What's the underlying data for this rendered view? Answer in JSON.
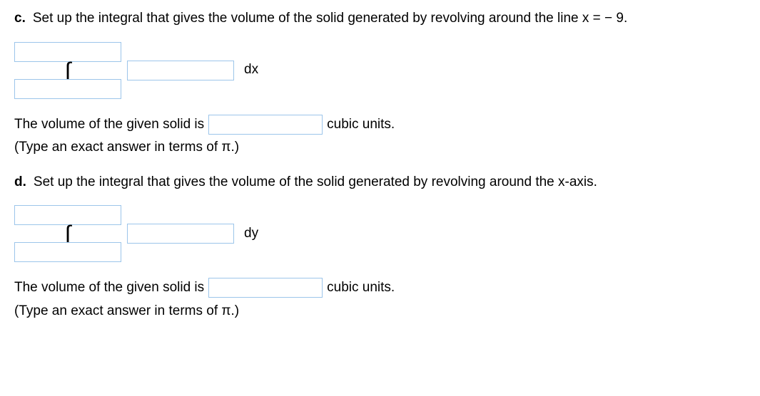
{
  "parts": {
    "c": {
      "letter": "c.",
      "prompt": "Set up the integral that gives the volume of the solid generated by revolving around the line x = − 9.",
      "differential": "dx",
      "answer_prefix": "The volume of the given solid is",
      "answer_suffix": "cubic units.",
      "hint": "(Type an exact answer in terms of π.)"
    },
    "d": {
      "letter": "d.",
      "prompt": "Set up the integral that gives the volume of the solid generated by revolving around the x-axis.",
      "differential": "dy",
      "answer_prefix": "The volume of the given solid is",
      "answer_suffix": "cubic units.",
      "hint": "(Type an exact answer in terms of π.)"
    }
  },
  "symbols": {
    "integral": "∫"
  }
}
